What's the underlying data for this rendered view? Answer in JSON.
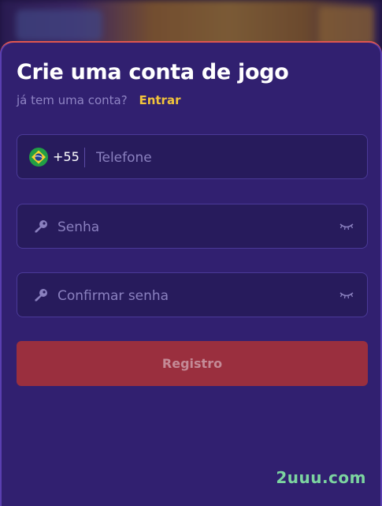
{
  "form": {
    "title": "Crie uma conta de jogo",
    "subtitle": "já tem uma conta?",
    "login_link": "Entrar",
    "phone": {
      "country_icon": "brazil-flag-icon",
      "dial_code": "+55",
      "placeholder": "Telefone",
      "value": ""
    },
    "password": {
      "icon": "key-icon",
      "placeholder": "Senha",
      "value": "",
      "toggle_icon": "eye-closed-icon"
    },
    "confirm_password": {
      "icon": "key-icon",
      "placeholder": "Confirmar senha",
      "value": "",
      "toggle_icon": "eye-closed-icon"
    },
    "submit_label": "Registro"
  },
  "watermark": "2uuu.com",
  "colors": {
    "panel": "#312070",
    "field": "#271b5c",
    "accent_link": "#f2c33b",
    "button": "#9a2f3e",
    "top_border": "#e0564f"
  }
}
